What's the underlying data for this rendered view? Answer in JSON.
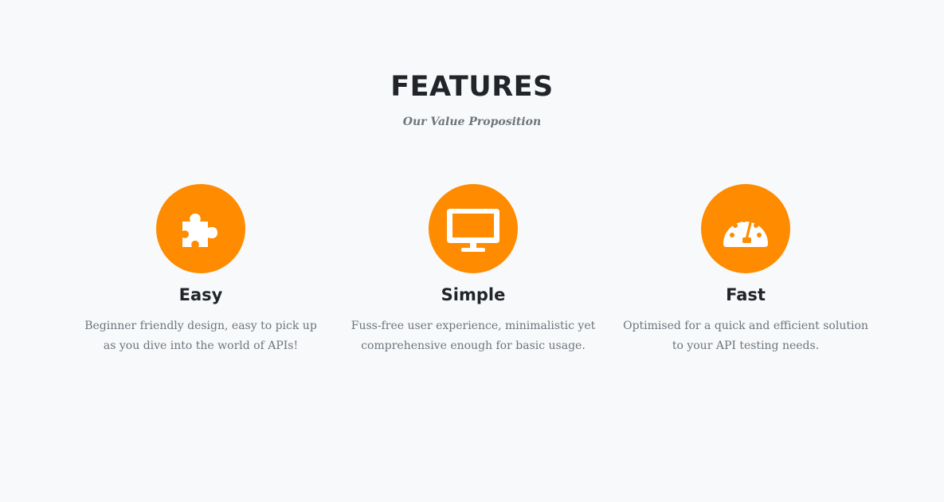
{
  "header": {
    "title": "FEATURES",
    "subtitle": "Our Value Proposition"
  },
  "accent_color": "#fe8b00",
  "features": [
    {
      "icon": "puzzle-piece-icon",
      "title": "Easy",
      "text": "Beginner friendly design, easy to pick up as you dive into the world of APIs!"
    },
    {
      "icon": "desktop-monitor-icon",
      "title": "Simple",
      "text": "Fuss-free user experience, minimalistic yet comprehensive enough for basic usage."
    },
    {
      "icon": "speedometer-icon",
      "title": "Fast",
      "text": "Optimised for a quick and efficient solution to your API testing needs."
    }
  ]
}
